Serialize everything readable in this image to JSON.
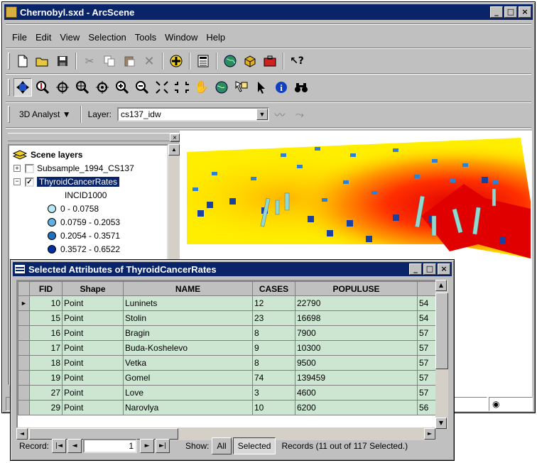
{
  "app": {
    "title": "Chernobyl.sxd - ArcScene"
  },
  "window_controls": {
    "minimize": "_",
    "maximize": "□",
    "close": "×"
  },
  "menu": [
    "File",
    "Edit",
    "View",
    "Selection",
    "Tools",
    "Window",
    "Help"
  ],
  "toolbar1": [
    "new-document",
    "open-folder",
    "save",
    "cut",
    "copy",
    "paste",
    "delete",
    "add-data",
    "properties",
    "full-extent",
    "cube",
    "toolbox",
    "whats-this"
  ],
  "toolbar2": [
    "navigate",
    "zoom-in-out",
    "center-on-target",
    "zoom-to-target",
    "set-observer",
    "zoom-in",
    "zoom-out",
    "fixed-zoom-in",
    "fixed-zoom-out",
    "pan",
    "full-extent-globe",
    "select-features",
    "select-elements",
    "identify",
    "find"
  ],
  "toolbar3": {
    "analyst_label": "3D Analyst ▼",
    "layer_label": "Layer:",
    "layer_value": "cs137_idw"
  },
  "toc": {
    "header": "Scene layers",
    "layers": [
      {
        "name": "Subsample_1994_CS137",
        "checked": false,
        "expand": "+"
      },
      {
        "name": "ThyroidCancerRates",
        "checked": true,
        "expand": "−",
        "selected": true
      }
    ],
    "field": "INCID1000",
    "classes": [
      {
        "label": "0 - 0.0758",
        "color": "#b8e8f8"
      },
      {
        "label": "0.0759 - 0.2053",
        "color": "#60b0e0"
      },
      {
        "label": "0.2054 - 0.3571",
        "color": "#2070c0"
      },
      {
        "label": "0.3572 - 0.6522",
        "color": "#0030a0"
      }
    ]
  },
  "table": {
    "title": "Selected Attributes of ThyroidCancerRates",
    "columns": [
      "FID",
      "Shape",
      "NAME",
      "CASES",
      "POPULUSE",
      ""
    ],
    "rows": [
      {
        "fid": "10",
        "shape": "Point",
        "name": "Luninets",
        "cases": "12",
        "pop": "22790",
        "next": "54"
      },
      {
        "fid": "15",
        "shape": "Point",
        "name": "Stolin",
        "cases": "23",
        "pop": "16698",
        "next": "54"
      },
      {
        "fid": "16",
        "shape": "Point",
        "name": "Bragin",
        "cases": "8",
        "pop": "7900",
        "next": "57"
      },
      {
        "fid": "17",
        "shape": "Point",
        "name": "Buda-Koshelevo",
        "cases": "9",
        "pop": "10300",
        "next": "57"
      },
      {
        "fid": "18",
        "shape": "Point",
        "name": "Vetka",
        "cases": "8",
        "pop": "9500",
        "next": "57"
      },
      {
        "fid": "19",
        "shape": "Point",
        "name": "Gomel",
        "cases": "74",
        "pop": "139459",
        "next": "57"
      },
      {
        "fid": "27",
        "shape": "Point",
        "name": "Love",
        "cases": "3",
        "pop": "4600",
        "next": "57"
      },
      {
        "fid": "29",
        "shape": "Point",
        "name": "Narovlya",
        "cases": "10",
        "pop": "6200",
        "next": "56"
      }
    ],
    "record_label": "Record:",
    "record_value": "1",
    "show_label": "Show:",
    "all_label": "All",
    "selected_label": "Selected",
    "records_text": "Records (11 out of 117 Selected.)"
  }
}
